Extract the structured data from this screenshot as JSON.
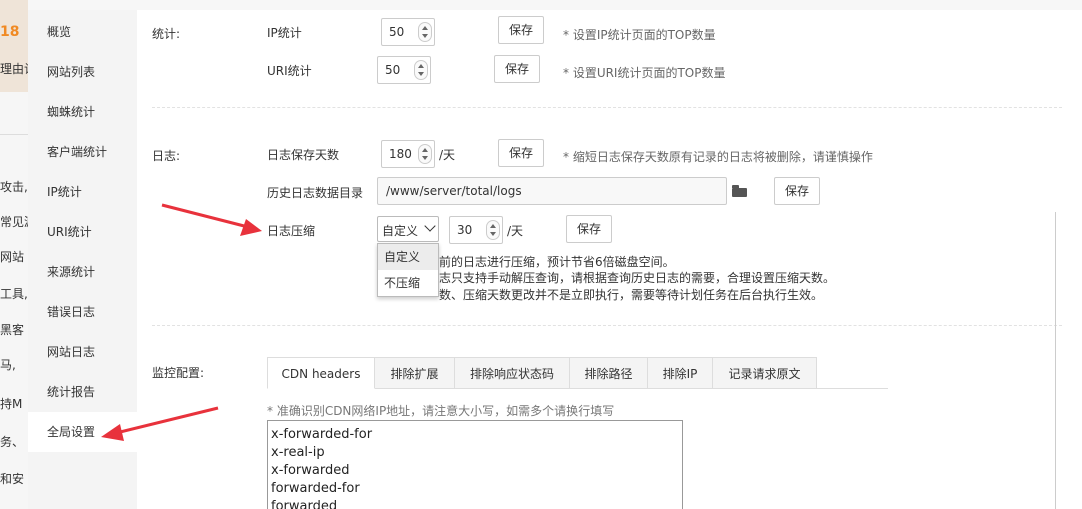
{
  "background": {
    "accent_text": "18",
    "rows": [
      "理由让",
      "攻击,…",
      "常见漏",
      "网站",
      "工具,",
      "黑客",
      "马, ",
      "持M",
      "务、",
      "和安"
    ]
  },
  "sidebar": {
    "items": [
      {
        "label": "概览"
      },
      {
        "label": "网站列表"
      },
      {
        "label": "蜘蛛统计"
      },
      {
        "label": "客户端统计"
      },
      {
        "label": "IP统计"
      },
      {
        "label": "URI统计"
      },
      {
        "label": "来源统计"
      },
      {
        "label": "错误日志"
      },
      {
        "label": "网站日志"
      },
      {
        "label": "统计报告"
      },
      {
        "label": "全局设置"
      }
    ]
  },
  "stats": {
    "section_label": "统计:",
    "ip_label": "IP统计",
    "ip_value": "50",
    "ip_save": "保存",
    "ip_hint": "* 设置IP统计页面的TOP数量",
    "uri_label": "URI统计",
    "uri_value": "50",
    "uri_save": "保存",
    "uri_hint": "* 设置URI统计页面的TOP数量"
  },
  "logs": {
    "section_label": "日志:",
    "keep_days_label": "日志保存天数",
    "keep_days_value": "180",
    "keep_days_unit": "/天",
    "keep_days_save": "保存",
    "keep_days_hint": "* 缩短日志保存天数原有记录的日志将被删除，请谨慎操作",
    "dir_label": "历史日志数据目录",
    "dir_value": "/www/server/total/logs",
    "dir_save": "保存",
    "compress_label": "日志压缩",
    "compress_select": "自定义",
    "compress_days": "30",
    "compress_unit": "/天",
    "compress_save": "保存",
    "compress_options": [
      "自定义",
      "不压缩"
    ],
    "notes": [
      "前的日志进行压缩，预计节省6倍磁盘空间。",
      "志只支持手动解压查询，请根据查询历史日志的需要，合理设置压缩天数。",
      "数、压缩天数更改并不是立即执行，需要等待计划任务在后台执行生效。"
    ]
  },
  "monitor": {
    "section_label": "监控配置:",
    "tabs": [
      "CDN headers",
      "排除扩展",
      "排除响应状态码",
      "排除路径",
      "排除IP",
      "记录请求原文"
    ],
    "hint": "* 准确识别CDN网络IP地址，请注意大小写，如需多个请换行填写",
    "headers": [
      "x-forwarded-for",
      "x-real-ip",
      "x-forwarded",
      "forwarded-for",
      "forwarded"
    ]
  },
  "colors": {
    "accent": "#f08a24",
    "arrow": "#e8323c"
  }
}
